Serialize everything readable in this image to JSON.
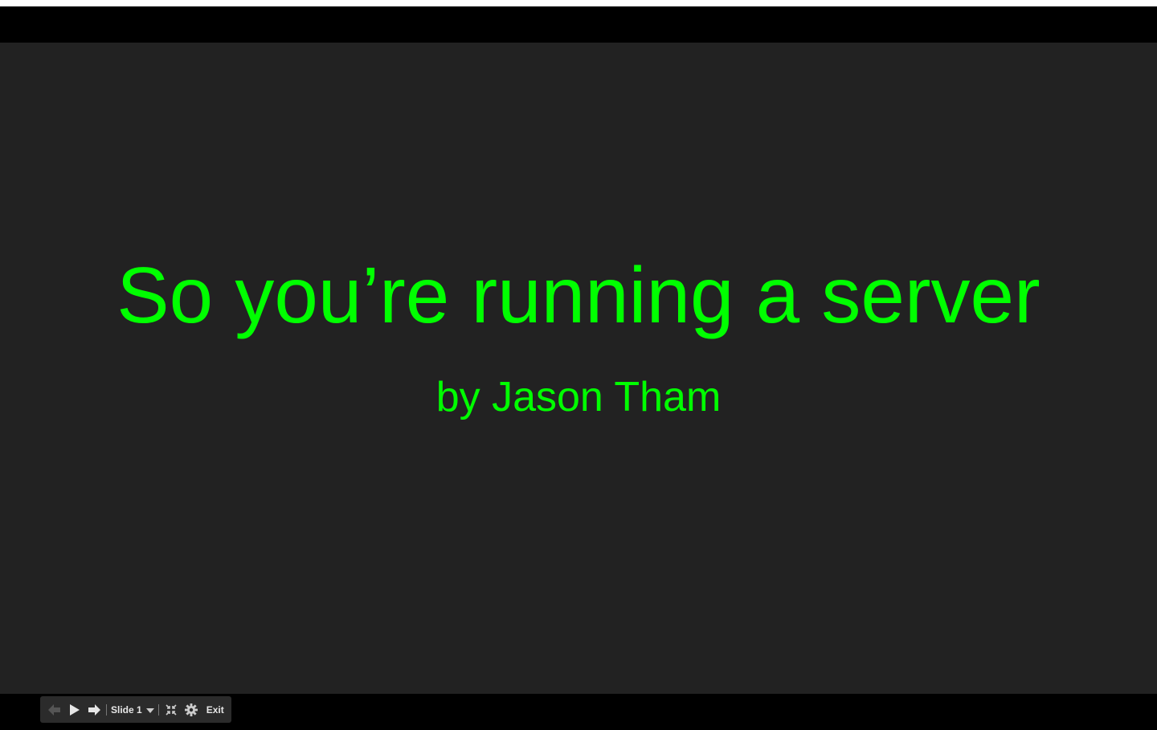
{
  "slide": {
    "title": "So you’re running a server",
    "subtitle": "by Jason Tham",
    "background_color": "#222222",
    "text_color": "#00ff00"
  },
  "controls": {
    "icons": [
      "previous-arrow-icon",
      "play-icon",
      "next-arrow-icon",
      "chevron-down-icon",
      "exit-fullscreen-icon",
      "gear-icon"
    ],
    "slide_selector_label": "Slide 1",
    "exit_label": "Exit"
  }
}
